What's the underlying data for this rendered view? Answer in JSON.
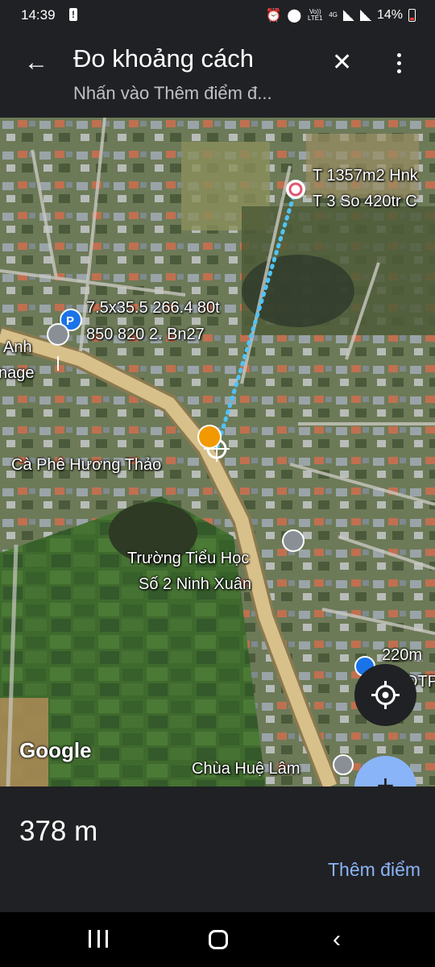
{
  "status_bar": {
    "time": "14:39",
    "battery": "14%",
    "network": "4G",
    "volte": "Vo)) LTE1"
  },
  "app_bar": {
    "title": "Đo khoảng cách",
    "subtitle": "Nhấn vào Thêm điểm đ..."
  },
  "map": {
    "labels": {
      "listing_top_1": "T 1357m2 Hnk",
      "listing_top_2": "T 3 So 420tr C",
      "parking_1": "7.5x35.5 266.4 80t",
      "parking_2": "850 820 2. Bn27",
      "anh_1": "Anh",
      "anh_2": "nage",
      "cafe": "Cà Phê Hương Thảo",
      "school_1": "Trường Tiểu Học",
      "school_2": "Số 2 Ninh Xuân",
      "right_listing": "220m",
      "right_listing_2": "DTP",
      "pagoda": "Chùa Huệ Lâm",
      "google": "Google"
    }
  },
  "bottom": {
    "distance": "378 m",
    "add_point": "Thêm điểm"
  },
  "colors": {
    "background": "#202124",
    "accent": "#8ab4f8",
    "measure_line": "#4fc3f7",
    "road": "#c8b07a"
  }
}
